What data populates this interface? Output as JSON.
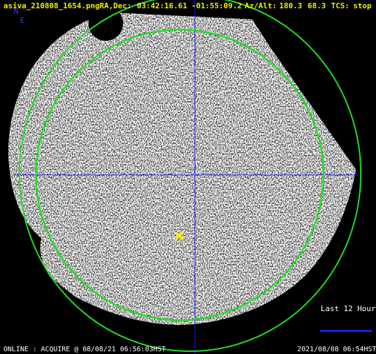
{
  "header": {
    "filename": "asiva_210808_1654.png",
    "radec_label": "RA,Dec:",
    "ra": "03:42:16.61",
    "dec": "-01:55:09.2",
    "azalt_label": "Az/Alt:",
    "az": "180.3",
    "alt": "68.3",
    "tcs_label": "TCS:",
    "tcs_status": "stop"
  },
  "compass": {
    "north": "N",
    "east": "E"
  },
  "legend": {
    "label": "Last 12 Hours"
  },
  "footer": {
    "status": "ONLINE : ACQUIRE @ 08/08/21 06:56:03HST",
    "timestamp": "2021/08/08 06:54HST"
  },
  "colors": {
    "circle": "#22dd22",
    "crosshair": "#1a1aff",
    "header_text": "#f0f000",
    "marker": "#ffee00"
  },
  "icons": {
    "target_marker": "x-marker-icon"
  }
}
